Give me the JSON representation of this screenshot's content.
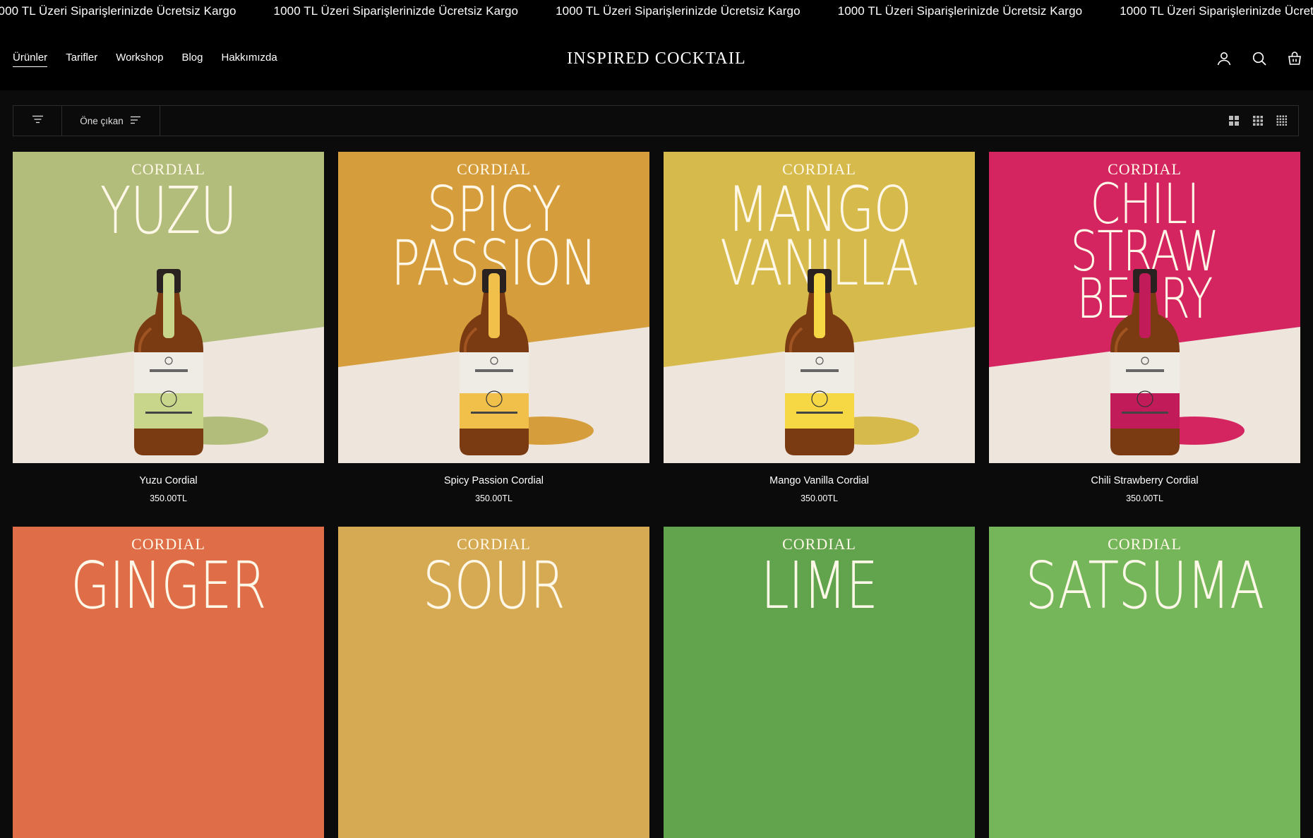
{
  "announcement": {
    "items": [
      "1000 TL Üzeri Siparişlerinizde Ücretsiz Kargo",
      "1000 TL Üzeri Siparişlerinizde Ücretsiz Kargo",
      "1000 TL Üzeri Siparişlerinizde Ücretsiz Kargo",
      "1000 TL Üzeri Siparişlerinizde Ücretsiz Kargo",
      "1000 TL Üzeri Siparişlerinizde Ücretsiz Kargo",
      "1000 TL Üzeri Siparişlerinizde Ücretsiz Kargo",
      "1000 TL Üzeri Siparişlerinizde Ücretsiz Kargo"
    ]
  },
  "header": {
    "logo": "INSPIRED COCKTAIL",
    "nav": [
      "Ürünler",
      "Tarifler",
      "Workshop",
      "Blog",
      "Hakkımızda"
    ],
    "icons": [
      "account-icon",
      "search-icon",
      "cart-icon"
    ]
  },
  "toolbar": {
    "sort_label": "Öne çıkan",
    "icons": [
      "filter-icon",
      "sort-icon",
      "grid-2-icon",
      "grid-3-icon",
      "grid-4-icon"
    ]
  },
  "products": [
    {
      "name": "Yuzu Cordial",
      "price": "350.00TL",
      "category": "CORDIAL",
      "title_lines": [
        "YUZU"
      ],
      "bg": "#b2bd7c",
      "accent": "#b2bd7c",
      "label": "#c7d68a"
    },
    {
      "name": "Spicy Passion Cordial",
      "price": "350.00TL",
      "category": "CORDIAL",
      "title_lines": [
        "SPICY",
        "PASSION"
      ],
      "bg": "#d69d3c",
      "accent": "#d69d3c",
      "label": "#f1c04a"
    },
    {
      "name": "Mango Vanilla Cordial",
      "price": "350.00TL",
      "category": "CORDIAL",
      "title_lines": [
        "MANGO",
        "VANILLA"
      ],
      "bg": "#d6bb4c",
      "accent": "#d6bb4c",
      "label": "#f6d845"
    },
    {
      "name": "Chili Strawberry Cordial",
      "price": "350.00TL",
      "category": "CORDIAL",
      "title_lines": [
        "CHILI",
        "STRAW",
        "BERRY"
      ],
      "bg": "#d42561",
      "accent": "#d42561",
      "label": "#c21b5a"
    },
    {
      "category": "CORDIAL",
      "title_lines": [
        "GINGER"
      ],
      "bg": "#df6e48"
    },
    {
      "category": "CORDIAL",
      "title_lines": [
        "SOUR"
      ],
      "bg": "#d6aa52"
    },
    {
      "category": "CORDIAL",
      "title_lines": [
        "LIME"
      ],
      "bg": "#62a34e"
    },
    {
      "category": "CORDIAL",
      "title_lines": [
        "SATSUMA"
      ],
      "bg": "#75b65a"
    }
  ]
}
